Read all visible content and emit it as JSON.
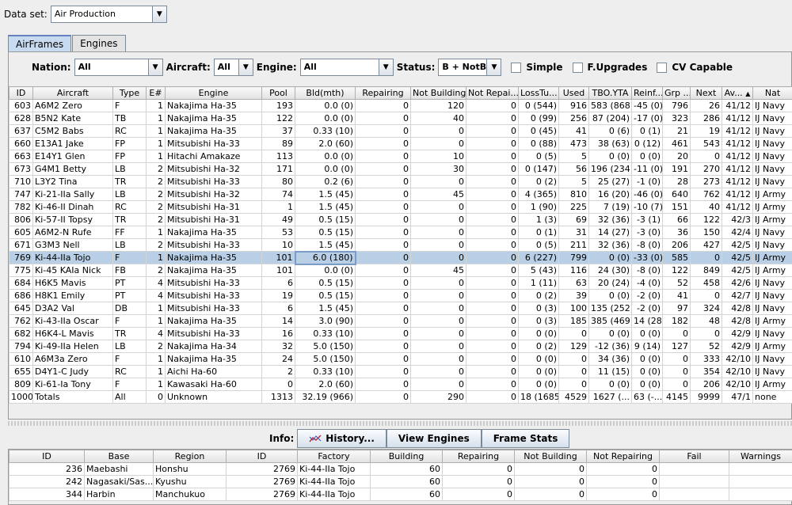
{
  "dataset": {
    "label": "Data set:",
    "value": "Air Production"
  },
  "tabs": [
    {
      "label": "AirFrames"
    },
    {
      "label": "Engines"
    }
  ],
  "filters": {
    "nation_label": "Nation:",
    "nation_value": "All",
    "aircraft_label": "Aircraft:",
    "aircraft_value": "All",
    "engine_label": "Engine:",
    "engine_value": "All",
    "status_label": "Status:",
    "status_value": "B + NotB",
    "simple_label": "Simple",
    "fupgrades_label": "F.Upgrades",
    "cv_label": "CV Capable"
  },
  "main_table": {
    "columns": [
      "ID",
      "Aircraft",
      "Type",
      "E#",
      "Engine",
      "Pool",
      "Bld(mth)",
      "Repairing",
      "Not Building",
      "Not Repai...",
      "LossTu...",
      "Used",
      "TBO.YTA",
      "Reinf...",
      "Grp ...",
      "Next",
      "Av...",
      "Nat"
    ],
    "sort_indicator": "▲",
    "rows": [
      [
        "603",
        "A6M2 Zero",
        "F",
        "1",
        "Nakajima Ha-35",
        "193",
        "0.0 (0)",
        "0",
        "120",
        "0",
        "0 (544)",
        "916",
        "583 (868)",
        "-45 (0)",
        "796",
        "26",
        "41/12",
        "IJ Navy"
      ],
      [
        "628",
        "B5N2 Kate",
        "TB",
        "1",
        "Nakajima Ha-35",
        "122",
        "0.0 (0)",
        "0",
        "40",
        "0",
        "0 (99)",
        "256",
        "87 (204)",
        "-17 (0)",
        "323",
        "286",
        "41/12",
        "IJ Navy"
      ],
      [
        "637",
        "C5M2 Babs",
        "RC",
        "1",
        "Nakajima Ha-35",
        "37",
        "0.33 (10)",
        "0",
        "0",
        "0",
        "0 (45)",
        "41",
        "0 (6)",
        "0 (1)",
        "21",
        "19",
        "41/12",
        "IJ Navy"
      ],
      [
        "660",
        "E13A1 Jake",
        "FP",
        "1",
        "Mitsubishi Ha-33",
        "89",
        "2.0 (60)",
        "0",
        "0",
        "0",
        "0 (88)",
        "473",
        "38 (63)",
        "0 (12)",
        "461",
        "543",
        "41/12",
        "IJ Navy"
      ],
      [
        "663",
        "E14Y1 Glen",
        "FP",
        "1",
        "Hitachi Amakaze",
        "113",
        "0.0 (0)",
        "0",
        "10",
        "0",
        "0 (5)",
        "5",
        "0 (0)",
        "0 (0)",
        "20",
        "0",
        "41/12",
        "IJ Navy"
      ],
      [
        "673",
        "G4M1 Betty",
        "LB",
        "2",
        "Mitsubishi Ha-32",
        "171",
        "0.0 (0)",
        "0",
        "30",
        "0",
        "0 (147)",
        "56",
        "196 (234)",
        "-11 (0)",
        "191",
        "270",
        "41/12",
        "IJ Navy"
      ],
      [
        "710",
        "L3Y2 Tina",
        "TR",
        "2",
        "Mitsubishi Ha-33",
        "80",
        "0.2 (6)",
        "0",
        "0",
        "0",
        "0 (2)",
        "5",
        "25 (27)",
        "-1 (0)",
        "28",
        "273",
        "41/12",
        "IJ Navy"
      ],
      [
        "747",
        "Ki-21-IIa Sally",
        "LB",
        "2",
        "Mitsubishi Ha-32",
        "74",
        "1.5 (45)",
        "0",
        "45",
        "0",
        "4 (365)",
        "810",
        "16 (20)",
        "-46 (0)",
        "640",
        "762",
        "41/12",
        "IJ Army"
      ],
      [
        "782",
        "Ki-46-II Dinah",
        "RC",
        "2",
        "Mitsubishi Ha-31",
        "1",
        "1.5 (45)",
        "0",
        "0",
        "0",
        "1 (90)",
        "225",
        "7 (19)",
        "-10 (7)",
        "151",
        "40",
        "41/12",
        "IJ Army"
      ],
      [
        "806",
        "Ki-57-II Topsy",
        "TR",
        "2",
        "Mitsubishi Ha-31",
        "49",
        "0.5 (15)",
        "0",
        "0",
        "0",
        "1 (3)",
        "69",
        "32 (36)",
        "-3 (1)",
        "66",
        "122",
        "42/3",
        "IJ Army"
      ],
      [
        "605",
        "A6M2-N Rufe",
        "FF",
        "1",
        "Nakajima Ha-35",
        "53",
        "0.5 (15)",
        "0",
        "0",
        "0",
        "0 (1)",
        "31",
        "14 (27)",
        "-3 (0)",
        "36",
        "150",
        "42/4",
        "IJ Navy"
      ],
      [
        "671",
        "G3M3 Nell",
        "LB",
        "2",
        "Mitsubishi Ha-33",
        "10",
        "1.5 (45)",
        "0",
        "0",
        "0",
        "0 (5)",
        "211",
        "32 (36)",
        "-8 (0)",
        "206",
        "427",
        "42/5",
        "IJ Navy"
      ],
      [
        "769",
        "Ki-44-IIa Tojo",
        "F",
        "1",
        "Nakajima Ha-35",
        "101",
        "6.0 (180)",
        "0",
        "0",
        "0",
        "6 (227)",
        "799",
        "0 (0)",
        "-33 (0)",
        "585",
        "0",
        "42/5",
        "IJ Army"
      ],
      [
        "775",
        "Ki-45 KAIa Nick",
        "FB",
        "2",
        "Nakajima Ha-35",
        "101",
        "0.0 (0)",
        "0",
        "45",
        "0",
        "5 (43)",
        "116",
        "24 (30)",
        "-8 (0)",
        "122",
        "849",
        "42/5",
        "IJ Army"
      ],
      [
        "684",
        "H6K5 Mavis",
        "PT",
        "4",
        "Mitsubishi Ha-33",
        "6",
        "0.5 (15)",
        "0",
        "0",
        "0",
        "1 (11)",
        "63",
        "20 (24)",
        "-4 (0)",
        "52",
        "458",
        "42/6",
        "IJ Navy"
      ],
      [
        "686",
        "H8K1 Emily",
        "PT",
        "4",
        "Mitsubishi Ha-33",
        "19",
        "0.5 (15)",
        "0",
        "0",
        "0",
        "0 (2)",
        "39",
        "0 (0)",
        "-2 (0)",
        "41",
        "0",
        "42/7",
        "IJ Navy"
      ],
      [
        "645",
        "D3A2 Val",
        "DB",
        "1",
        "Mitsubishi Ha-33",
        "6",
        "1.5 (45)",
        "0",
        "0",
        "0",
        "0 (3)",
        "100",
        "135 (252)",
        "-2 (0)",
        "97",
        "324",
        "42/8",
        "IJ Navy"
      ],
      [
        "762",
        "Ki-43-IIa Oscar",
        "F",
        "1",
        "Nakajima Ha-35",
        "14",
        "3.0 (90)",
        "0",
        "0",
        "0",
        "0 (3)",
        "185",
        "385 (469)",
        "14 (28)",
        "182",
        "48",
        "42/8",
        "IJ Army"
      ],
      [
        "682",
        "H6K4-L Mavis",
        "TR",
        "4",
        "Mitsubishi Ha-33",
        "16",
        "0.33 (10)",
        "0",
        "0",
        "0",
        "0 (0)",
        "0",
        "0 (0)",
        "0 (0)",
        "0",
        "0",
        "42/9",
        "IJ Navy"
      ],
      [
        "794",
        "Ki-49-IIa Helen",
        "LB",
        "2",
        "Nakajima Ha-34",
        "32",
        "5.0 (150)",
        "0",
        "0",
        "0",
        "0 (2)",
        "129",
        "-12 (36)",
        "9 (14)",
        "127",
        "52",
        "42/9",
        "IJ Army"
      ],
      [
        "610",
        "A6M3a Zero",
        "F",
        "1",
        "Nakajima Ha-35",
        "24",
        "5.0 (150)",
        "0",
        "0",
        "0",
        "0 (0)",
        "0",
        "34 (36)",
        "0 (0)",
        "0",
        "333",
        "42/10",
        "IJ Navy"
      ],
      [
        "655",
        "D4Y1-C Judy",
        "RC",
        "1",
        "Aichi Ha-60",
        "2",
        "0.33 (10)",
        "0",
        "0",
        "0",
        "0 (0)",
        "0",
        "11 (15)",
        "0 (0)",
        "0",
        "354",
        "42/10",
        "IJ Navy"
      ],
      [
        "809",
        "Ki-61-Ia Tony",
        "F",
        "1",
        "Kawasaki Ha-60",
        "0",
        "2.0 (60)",
        "0",
        "0",
        "0",
        "0 (0)",
        "0",
        "0 (0)",
        "0 (0)",
        "0",
        "206",
        "42/10",
        "IJ Army"
      ],
      [
        "1000",
        "Totals",
        "All",
        "0",
        "Unknown",
        "1313",
        "32.19 (966)",
        "0",
        "290",
        "0",
        "18 (1685)",
        "4529",
        "1627 (...",
        "63 (-...",
        "4145",
        "9999",
        "47/1",
        "none"
      ]
    ],
    "selected_index": 12
  },
  "info": {
    "label": "Info:",
    "history": "History...",
    "view_engines": "View Engines",
    "frame_stats": "Frame Stats"
  },
  "bottom_table": {
    "columns": [
      "ID",
      "Base",
      "Region",
      "ID",
      "Factory",
      "Building",
      "Repairing",
      "Not Building",
      "Not Repairing",
      "Fail",
      "Warnings"
    ],
    "rows": [
      [
        "236",
        "Maebashi",
        "Honshu",
        "2769",
        "Ki-44-IIa Tojo",
        "60",
        "0",
        "0",
        "0",
        "",
        ""
      ],
      [
        "242",
        "Nagasaki/Sas...",
        "Kyushu",
        "2769",
        "Ki-44-IIa Tojo",
        "60",
        "0",
        "0",
        "0",
        "",
        ""
      ],
      [
        "344",
        "Harbin",
        "Manchukuo",
        "2769",
        "Ki-44-IIa Tojo",
        "60",
        "0",
        "0",
        "0",
        "",
        ""
      ]
    ]
  }
}
